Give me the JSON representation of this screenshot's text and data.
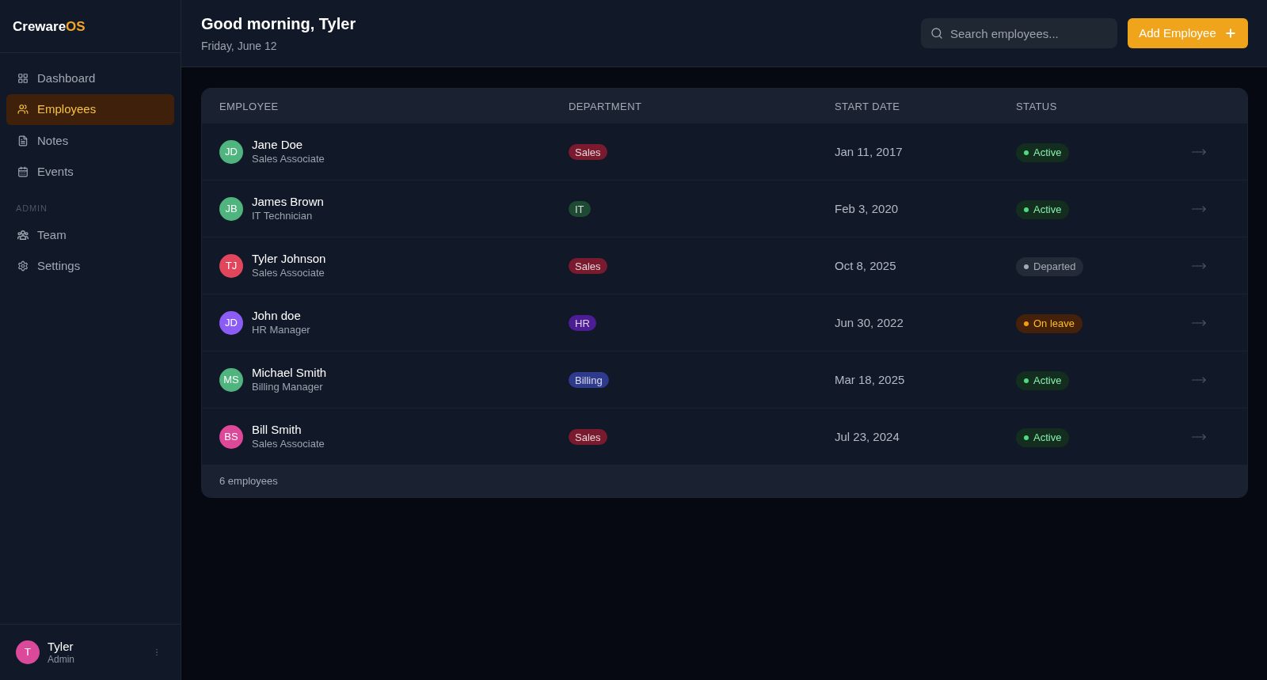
{
  "sidebar": {
    "logo": {
      "name": "Creware",
      "accent": "OS"
    },
    "sections": [
      {
        "items": [
          {
            "label": "Dashboard",
            "selected": false
          },
          {
            "label": "Employees",
            "selected": true
          },
          {
            "label": "Notes",
            "selected": false
          },
          {
            "label": "Events",
            "selected": false
          }
        ]
      },
      {
        "title": "ADMIN",
        "items": [
          {
            "label": "Team",
            "selected": false
          },
          {
            "label": "Settings",
            "selected": false
          }
        ]
      }
    ],
    "user": {
      "avatar": {
        "initials": "T",
        "color": "#db4a9a"
      },
      "name": "Tyler",
      "role": "Admin"
    }
  },
  "header": {
    "title": "Good morning, Tyler",
    "date": "Friday, June 12",
    "search": {
      "placeholder": "Search employees..."
    },
    "add_button": "Add Employee"
  },
  "table": {
    "columns": [
      "EMPLOYEE",
      "DEPARTMENT",
      "START DATE",
      "STATUS"
    ],
    "rows": [
      {
        "avatar": {
          "initials": "JD",
          "color": "#4fb47e"
        },
        "name": "Jane Doe",
        "role": "Sales Associate",
        "department": {
          "label": "Sales",
          "color": "#7a1a2e"
        },
        "start_date": "Jan 11, 2017",
        "status": {
          "label": "Active",
          "kind": "active"
        }
      },
      {
        "avatar": {
          "initials": "JB",
          "color": "#4fb47e"
        },
        "name": "James Brown",
        "role": "IT Technician",
        "department": {
          "label": "IT",
          "color": "#1e4a33"
        },
        "start_date": "Feb 3, 2020",
        "status": {
          "label": "Active",
          "kind": "active"
        }
      },
      {
        "avatar": {
          "initials": "TJ",
          "color": "#e2465c"
        },
        "name": "Tyler Johnson",
        "role": "Sales Associate",
        "department": {
          "label": "Sales",
          "color": "#7a1a2e"
        },
        "start_date": "Oct 8, 2025",
        "status": {
          "label": "Departed",
          "kind": "departed"
        }
      },
      {
        "avatar": {
          "initials": "JD",
          "color": "#8b5cf6"
        },
        "name": "John doe",
        "role": "HR Manager",
        "department": {
          "label": "HR",
          "color": "#4c1d95"
        },
        "start_date": "Jun 30, 2022",
        "status": {
          "label": "On leave",
          "kind": "on_leave"
        }
      },
      {
        "avatar": {
          "initials": "MS",
          "color": "#4fb47e"
        },
        "name": "Michael Smith",
        "role": "Billing Manager",
        "department": {
          "label": "Billing",
          "color": "#2e3a8c"
        },
        "start_date": "Mar 18, 2025",
        "status": {
          "label": "Active",
          "kind": "active"
        }
      },
      {
        "avatar": {
          "initials": "BS",
          "color": "#dd4898"
        },
        "name": "Bill Smith",
        "role": "Sales Associate",
        "department": {
          "label": "Sales",
          "color": "#7a1a2e"
        },
        "start_date": "Jul 23, 2024",
        "status": {
          "label": "Active",
          "kind": "active"
        }
      }
    ],
    "footer": "6 employees"
  }
}
